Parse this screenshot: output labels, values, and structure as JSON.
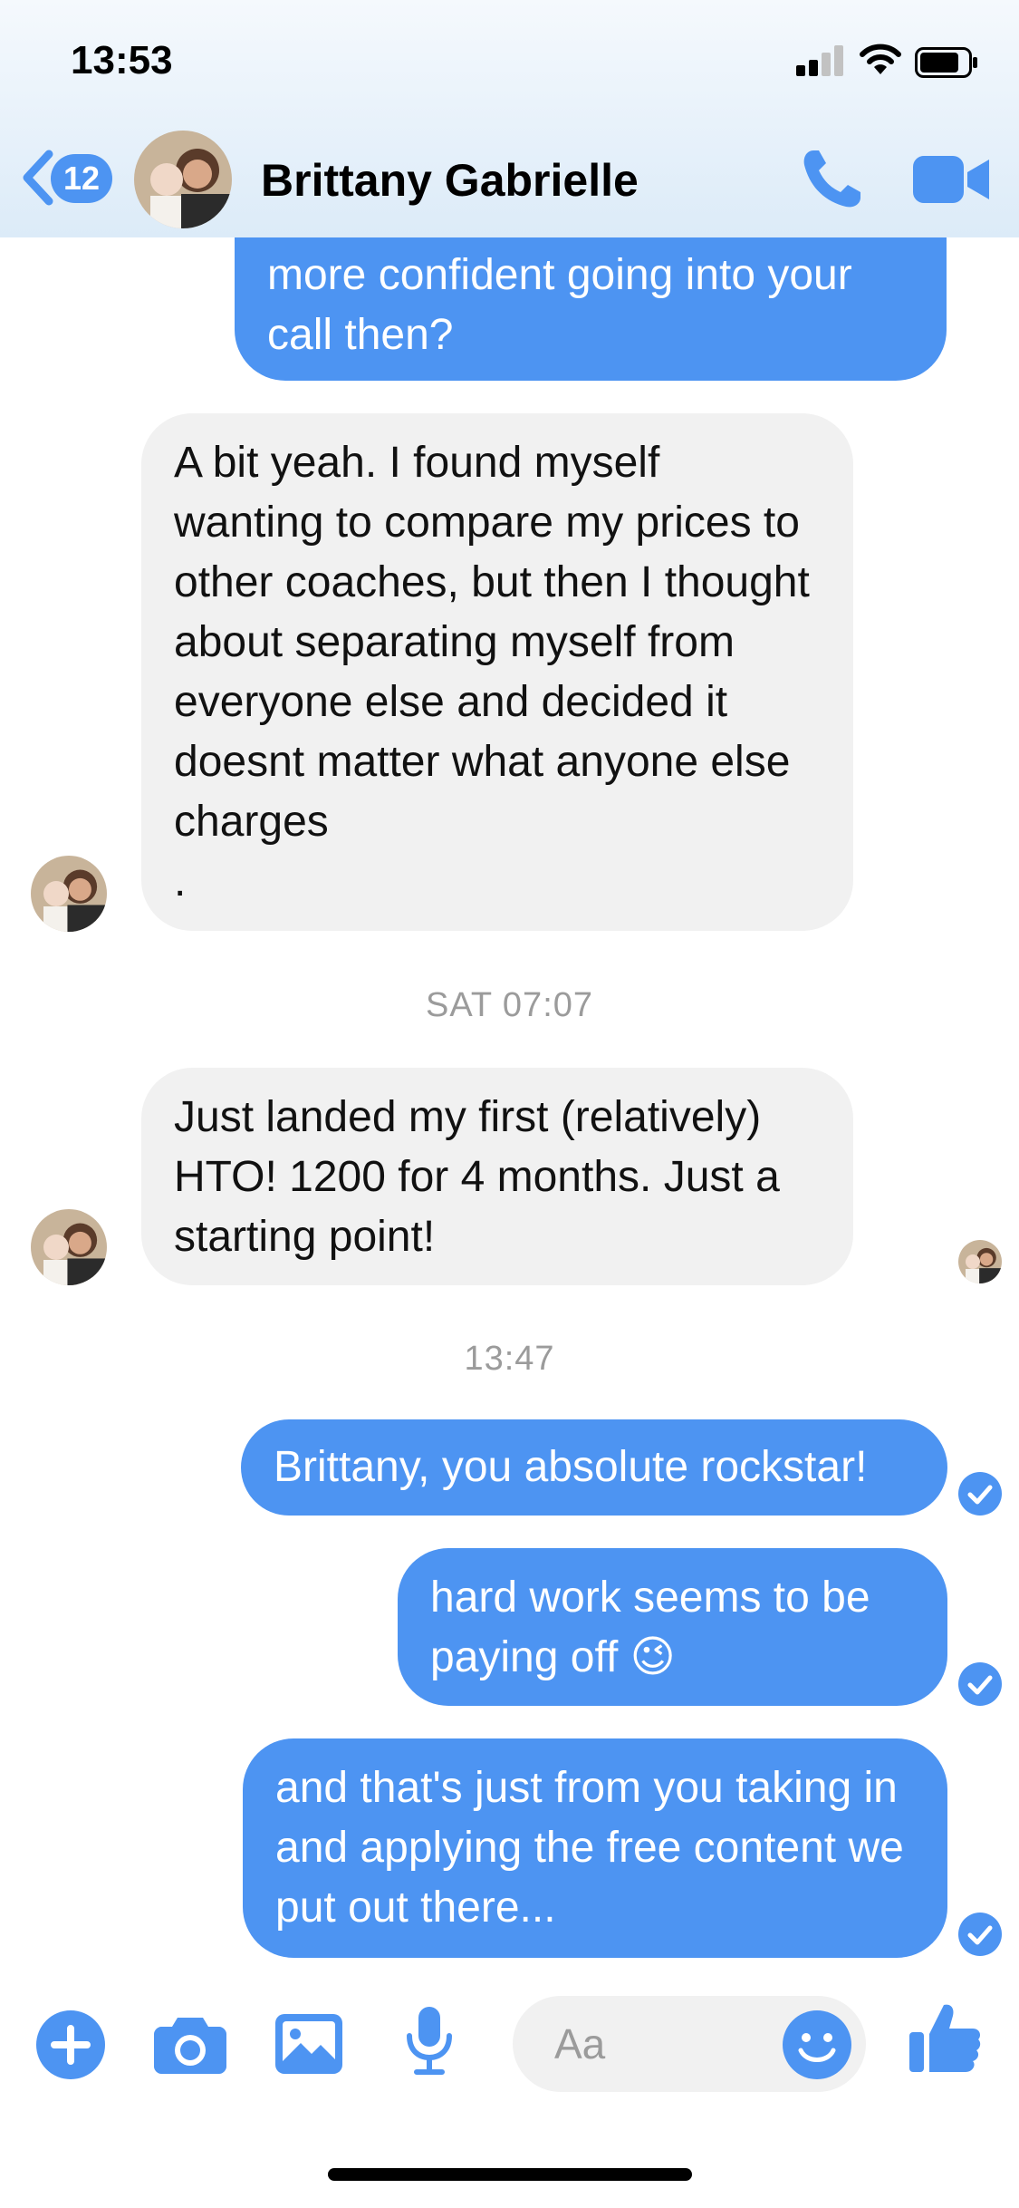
{
  "status_bar": {
    "time": "13:53"
  },
  "header": {
    "back_badge": "12",
    "contact_name": "Brittany Gabrielle",
    "icons": [
      "chevron-left-icon",
      "phone-icon",
      "video-camera-icon"
    ]
  },
  "messages": [
    {
      "side": "out",
      "text": "more confident going into your call then?"
    },
    {
      "side": "in",
      "text": "A bit yeah. I found myself wanting to compare my prices to other coaches, but then I thought about separating myself from everyone else and decided it doesnt matter what anyone else charges\n."
    },
    {
      "side": "time",
      "text": "SAT 07:07"
    },
    {
      "side": "in",
      "text": "Just landed my first (relatively) HTO! 1200 for 4 months. Just a starting point!"
    },
    {
      "side": "time",
      "text": "13:47"
    },
    {
      "side": "out",
      "text": "Brittany, you absolute rockstar!"
    },
    {
      "side": "out",
      "text": "hard work seems to be paying off 😉"
    },
    {
      "side": "out",
      "text": "and that's just from you taking in and applying the free content we put out there..."
    }
  ],
  "composer": {
    "placeholder": "Aa",
    "icons": [
      "plus-icon",
      "camera-icon",
      "image-icon",
      "microphone-icon",
      "emoji-icon",
      "thumbs-up-icon"
    ]
  },
  "colors": {
    "accent": "#4d94f2",
    "incoming_bubble": "#f1f1f1",
    "timestamp": "#9b9b9b"
  }
}
